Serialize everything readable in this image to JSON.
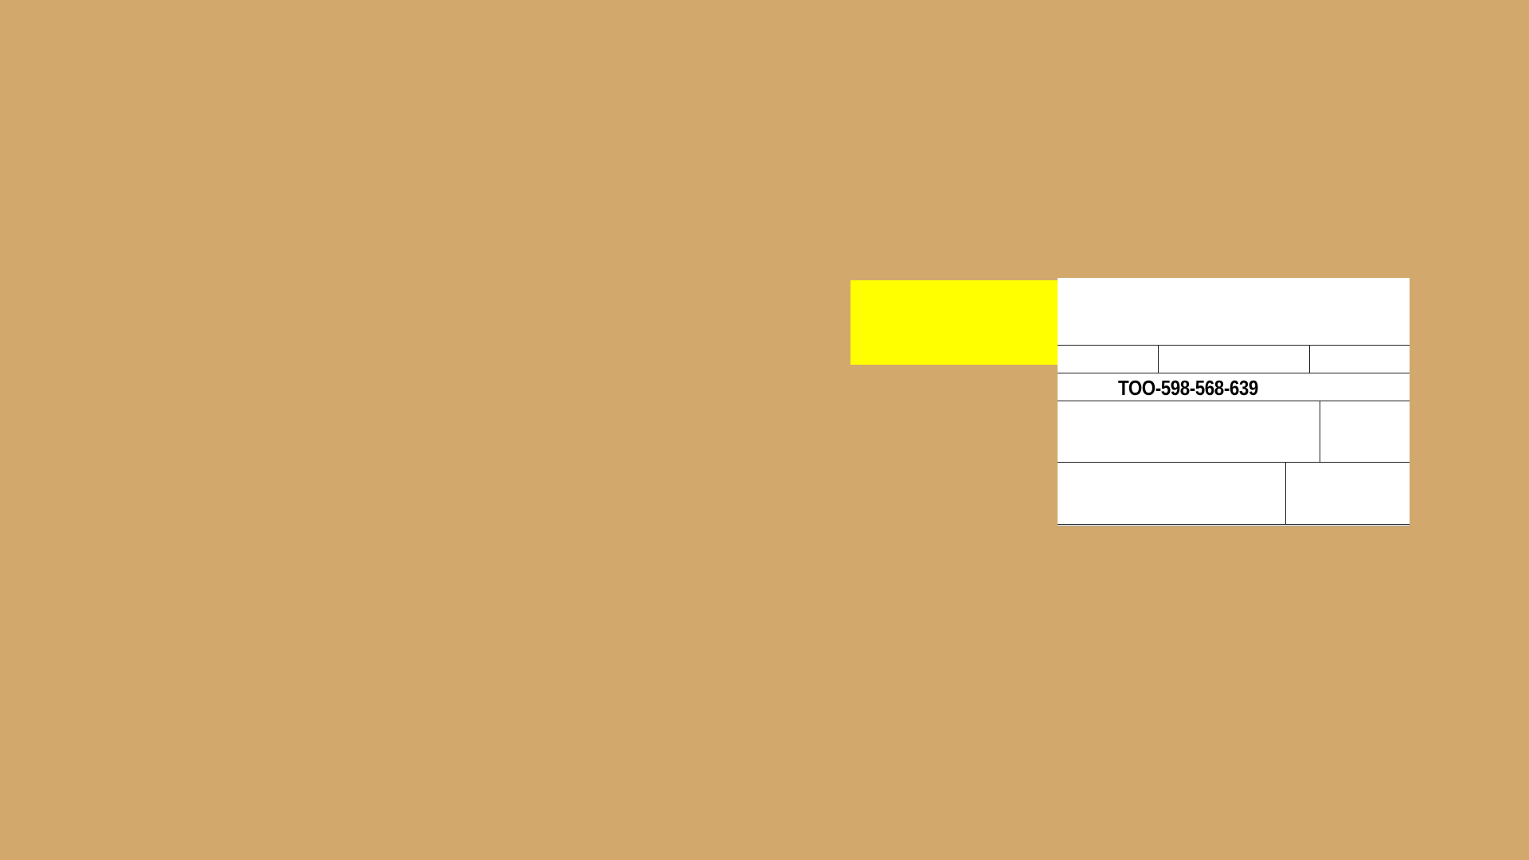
{
  "scene": {
    "background_color": "#d2a86d"
  },
  "yellow_tag": {
    "color": "#ffff00"
  },
  "shipping_label": {
    "background_color": "#ffffff",
    "line_color": "#222222",
    "tracking_number": "TOO-598-568-639"
  }
}
